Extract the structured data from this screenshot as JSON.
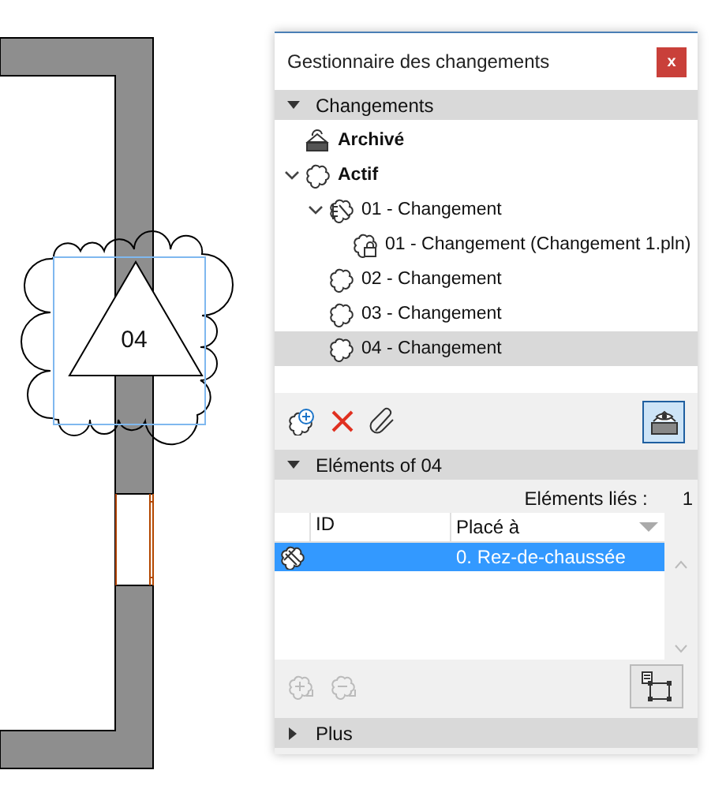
{
  "canvas": {
    "marker": "04"
  },
  "window": {
    "title": "Gestionnaire des changements",
    "close": "x"
  },
  "changes_section": {
    "title": "Changements",
    "expanded": true
  },
  "tree": [
    {
      "label": "Archivé",
      "kind": "archive",
      "selected": false
    },
    {
      "label": "Actif",
      "kind": "root",
      "selected": false,
      "expanded": true,
      "children": [
        {
          "label": "01 - Changement",
          "kind": "issue",
          "selected": false,
          "expanded": true,
          "children": [
            {
              "label": "01 - Changement (Changement 1.pln)",
              "kind": "linked",
              "selected": false
            }
          ]
        },
        {
          "label": "02 - Changement",
          "kind": "change",
          "selected": false
        },
        {
          "label": "03 - Changement",
          "kind": "change",
          "selected": false
        },
        {
          "label": "04 - Changement",
          "kind": "change",
          "selected": true
        }
      ]
    }
  ],
  "toolbar": [
    {
      "kind": "new"
    },
    {
      "kind": "delete"
    },
    {
      "kind": "attach"
    }
  ],
  "show_toggle": {
    "on": true
  },
  "elements_section": {
    "title": "Eléments of 04",
    "expanded": true
  },
  "linked_label": "Eléments liés :",
  "linked_count": "1",
  "columns": [
    "ID",
    "Placé à"
  ],
  "rows": [
    {
      "placed": "0. Rez-de-chaussée",
      "selected": true
    }
  ],
  "element_buttons": [
    {
      "kind": "add",
      "disabled": true
    },
    {
      "kind": "remove",
      "disabled": true
    }
  ],
  "more_section": {
    "title": "Plus",
    "expanded": false
  }
}
